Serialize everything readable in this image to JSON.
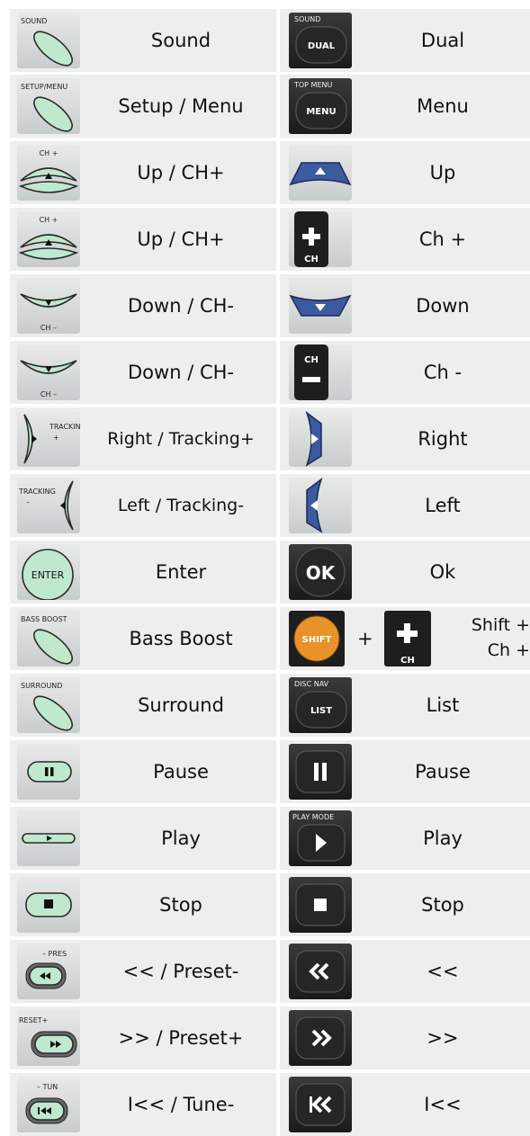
{
  "rows": [
    {
      "left": {
        "icon": "sound-oval-button-icon",
        "icon_text": "SOUND",
        "label": "Sound"
      },
      "right": {
        "icon": "dual-round-button-icon",
        "icon_text": "SOUND",
        "icon_btn": "DUAL",
        "label": "Dual"
      }
    },
    {
      "left": {
        "icon": "setup-menu-oval-button-icon",
        "icon_text": "SETUP/MENU",
        "label": "Setup / Menu"
      },
      "right": {
        "icon": "menu-round-button-icon",
        "icon_text": "TOP MENU",
        "icon_btn": "MENU",
        "label": "Menu"
      }
    },
    {
      "left": {
        "icon": "ch-plus-up-arrow-icon",
        "icon_text": "CH +",
        "label": "Up / CH+"
      },
      "right": {
        "icon": "blue-up-arrow-icon",
        "label": "Up"
      }
    },
    {
      "left": {
        "icon": "ch-plus-up-arrow-icon",
        "icon_text": "CH +",
        "label": "Up / CH+"
      },
      "right": {
        "icon": "ch-plus-rocker-icon",
        "icon_text": "CH",
        "label": "Ch +"
      }
    },
    {
      "left": {
        "icon": "ch-minus-down-arrow-icon",
        "icon_text": "CH –",
        "label": "Down / CH-"
      },
      "right": {
        "icon": "blue-down-arrow-icon",
        "label": "Down"
      }
    },
    {
      "left": {
        "icon": "ch-minus-down-arrow-icon",
        "icon_text": "CH –",
        "label": "Down / CH-"
      },
      "right": {
        "icon": "ch-minus-rocker-icon",
        "icon_text": "CH",
        "label": "Ch -"
      }
    },
    {
      "left": {
        "icon": "tracking-plus-right-arrow-icon",
        "icon_text": "TRACKING",
        "label": "Right / Tracking+"
      },
      "right": {
        "icon": "blue-right-arrow-icon",
        "label": "Right"
      }
    },
    {
      "left": {
        "icon": "tracking-minus-left-arrow-icon",
        "icon_text": "TRACKING",
        "label": "Left / Tracking-"
      },
      "right": {
        "icon": "blue-left-arrow-icon",
        "label": "Left"
      }
    },
    {
      "left": {
        "icon": "enter-button-icon",
        "icon_text": "ENTER",
        "label": "Enter"
      },
      "right": {
        "icon": "ok-button-icon",
        "icon_text": "OK",
        "label": "Ok"
      }
    },
    {
      "left": {
        "icon": "bass-boost-oval-button-icon",
        "icon_text": "BASS BOOST",
        "label": "Bass Boost"
      },
      "right": {
        "icon": "shift-plus-ch-icon",
        "icon_btn": "SHIFT",
        "plus": "+",
        "label_line1": "Shift +",
        "label_line2": "Ch +"
      }
    },
    {
      "left": {
        "icon": "surround-oval-button-icon",
        "icon_text": "SURROUND",
        "label": "Surround"
      },
      "right": {
        "icon": "list-round-button-icon",
        "icon_text": "DISC NAV",
        "icon_btn": "LIST",
        "label": "List"
      }
    },
    {
      "left": {
        "icon": "pause-pill-button-icon",
        "label": "Pause"
      },
      "right": {
        "icon": "pause-dark-button-icon",
        "label": "Pause"
      }
    },
    {
      "left": {
        "icon": "play-pill-button-icon",
        "label": "Play"
      },
      "right": {
        "icon": "play-dark-button-icon",
        "icon_text": "PLAY MODE",
        "label": "Play"
      }
    },
    {
      "left": {
        "icon": "stop-pill-button-icon",
        "label": "Stop"
      },
      "right": {
        "icon": "stop-dark-button-icon",
        "label": "Stop"
      }
    },
    {
      "left": {
        "icon": "rewind-preset-minus-button-icon",
        "icon_text": "– PRES",
        "label": "<< / Preset-"
      },
      "right": {
        "icon": "rewind-dark-button-icon",
        "label": "<<"
      }
    },
    {
      "left": {
        "icon": "fastforward-preset-plus-button-icon",
        "icon_text": "RESET+",
        "label": ">> / Preset+"
      },
      "right": {
        "icon": "fastforward-dark-button-icon",
        "label": ">>"
      }
    },
    {
      "left": {
        "icon": "skip-back-tune-minus-button-icon",
        "icon_text": "– TUN",
        "label": "I<< / Tune-"
      },
      "right": {
        "icon": "skip-back-dark-button-icon",
        "label": "I<<"
      }
    }
  ],
  "colors": {
    "cell_bg": "#eeeeee",
    "mint": "#bfe8cf",
    "blue": "#3c5aa0",
    "dark": "#262626",
    "shift_orange": "#e8922a"
  }
}
